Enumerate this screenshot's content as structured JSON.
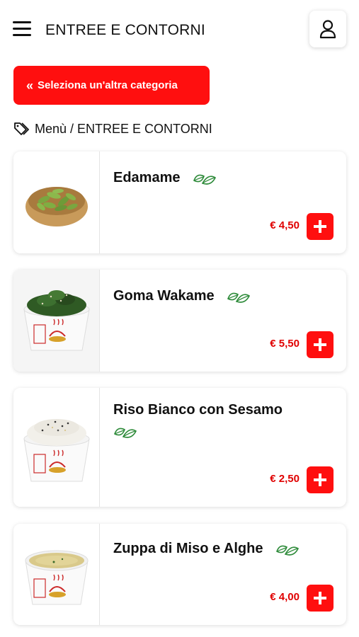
{
  "header": {
    "title": "ENTREE E CONTORNI",
    "menu_icon": "hamburger-menu-icon",
    "account_icon": "user-icon"
  },
  "category_button": {
    "chevrons": "«",
    "label": "Seleziona un'altra categoria"
  },
  "breadcrumb": {
    "icon": "tag-icon",
    "text": "Menù / ENTREE E CONTORNI"
  },
  "colors": {
    "accent": "#ff0f0f",
    "price": "#e00000",
    "leaf": "#2e8b3a"
  },
  "products": [
    {
      "name": "Edamame",
      "price": "€ 4,50",
      "vegetarian": true,
      "image": "edamame-bowl"
    },
    {
      "name": "Goma Wakame",
      "price": "€ 5,50",
      "vegetarian": true,
      "image": "seaweed-salad-cup"
    },
    {
      "name": "Riso Bianco con Sesamo",
      "price": "€ 2,50",
      "vegetarian": true,
      "image": "white-rice-cup"
    },
    {
      "name": "Zuppa di Miso e Alghe",
      "price": "€ 4,00",
      "vegetarian": true,
      "image": "miso-soup-cup"
    }
  ]
}
